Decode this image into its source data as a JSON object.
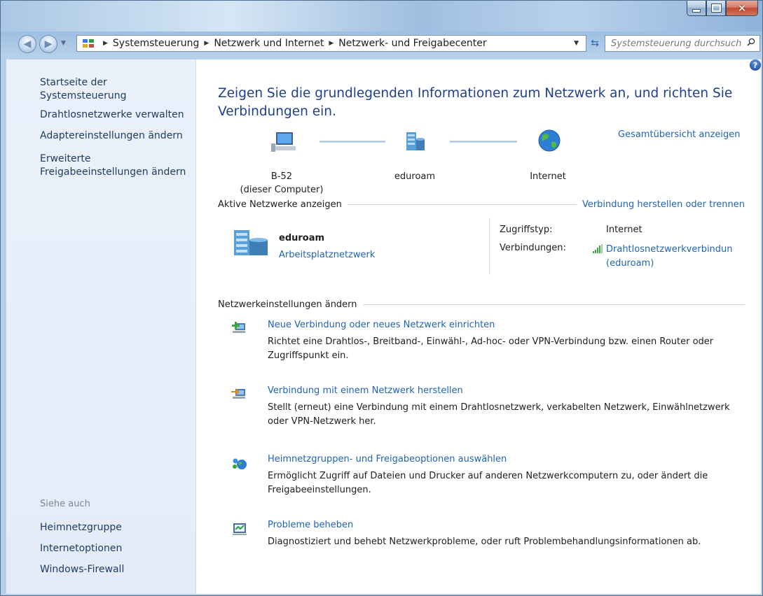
{
  "address_bar": {
    "crumbs": [
      "Systemsteuerung",
      "Netzwerk und Internet",
      "Netzwerk- und Freigabecenter"
    ]
  },
  "search": {
    "placeholder": "Systemsteuerung durchsuchen"
  },
  "sidebar": {
    "links": [
      "Startseite der Systemsteuerung",
      "Drahtlosnetzwerke verwalten",
      "Adaptereinstellungen ändern",
      "Erweiterte Freigabeeinstellungen ändern"
    ],
    "see_also_label": "Siehe auch",
    "see_also": [
      "Heimnetzgruppe",
      "Internetoptionen",
      "Windows-Firewall"
    ]
  },
  "main": {
    "title": "Zeigen Sie die grundlegenden Informationen zum Netzwerk an, und richten Sie Verbindungen ein.",
    "full_map_link": "Gesamtübersicht anzeigen",
    "map": {
      "computer_name": "B-52",
      "computer_sub": "(dieser Computer)",
      "network_name": "eduroam",
      "internet_label": "Internet"
    },
    "active_section": {
      "heading": "Aktive Netzwerke anzeigen",
      "connect_link": "Verbindung herstellen oder trennen",
      "network_name": "eduroam",
      "network_type": "Arbeitsplatznetzwerk",
      "access_type_label": "Zugriffstyp:",
      "access_type_value": "Internet",
      "connections_label": "Verbindungen:",
      "connection_link_line1": "Drahtlosnetzwerkverbindun",
      "connection_link_line2": "(eduroam)"
    },
    "settings_section": {
      "heading": "Netzwerkeinstellungen ändern",
      "tasks": [
        {
          "link": "Neue Verbindung oder neues Netzwerk einrichten",
          "desc": "Richtet eine Drahtlos-, Breitband-, Einwähl-, Ad-hoc- oder VPN-Verbindung bzw. einen Router oder Zugriffspunkt ein."
        },
        {
          "link": "Verbindung mit einem Netzwerk herstellen",
          "desc": "Stellt (erneut) eine Verbindung mit einem Drahtlosnetzwerk, verkabelten Netzwerk, Einwählnetzwerk oder VPN-Netzwerk her."
        },
        {
          "link": "Heimnetzgruppen- und Freigabeoptionen auswählen",
          "desc": "Ermöglicht Zugriff auf Dateien und Drucker auf anderen Netzwerkcomputern zu, oder ändert die Freigabeeinstellungen."
        },
        {
          "link": "Probleme beheben",
          "desc": "Diagnostiziert und behebt Netzwerkprobleme, oder ruft Problembehandlungsinformationen ab."
        }
      ]
    }
  },
  "colors": {
    "link": "#1f63b5",
    "title": "#1e3f8c",
    "sidebar_bg": "#e7eef9"
  }
}
